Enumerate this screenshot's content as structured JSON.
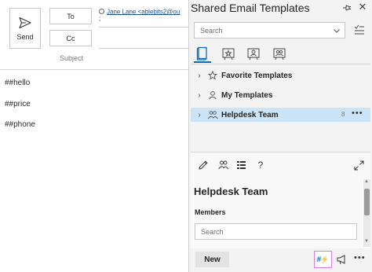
{
  "compose": {
    "send_label": "Send",
    "to_label": "To",
    "cc_label": "Cc",
    "to_recipient": "Jane Lane <ablebits2@ou",
    "to_separator": ";",
    "subject_label": "Subject",
    "body_lines": [
      "##hello",
      "##price",
      "##phone"
    ]
  },
  "pane": {
    "title": "Shared Email Templates",
    "search_placeholder": "Search",
    "tree": [
      {
        "label": "Favorite Templates",
        "icon": "star-icon"
      },
      {
        "label": "My Templates",
        "icon": "person-icon"
      },
      {
        "label": "Helpdesk Team",
        "icon": "team-icon",
        "count": "8",
        "selected": true
      }
    ],
    "preview": {
      "title": "Helpdesk Team",
      "members_label": "Members",
      "members_search_placeholder": "Search"
    },
    "new_button": "New",
    "more_label": "•••",
    "hashtag_label": "#"
  },
  "colors": {
    "accent": "#0f6cbd",
    "selected_row": "#cce4f7",
    "pane_background": "#f3f3f3",
    "highlight_border": "#d87be6"
  }
}
